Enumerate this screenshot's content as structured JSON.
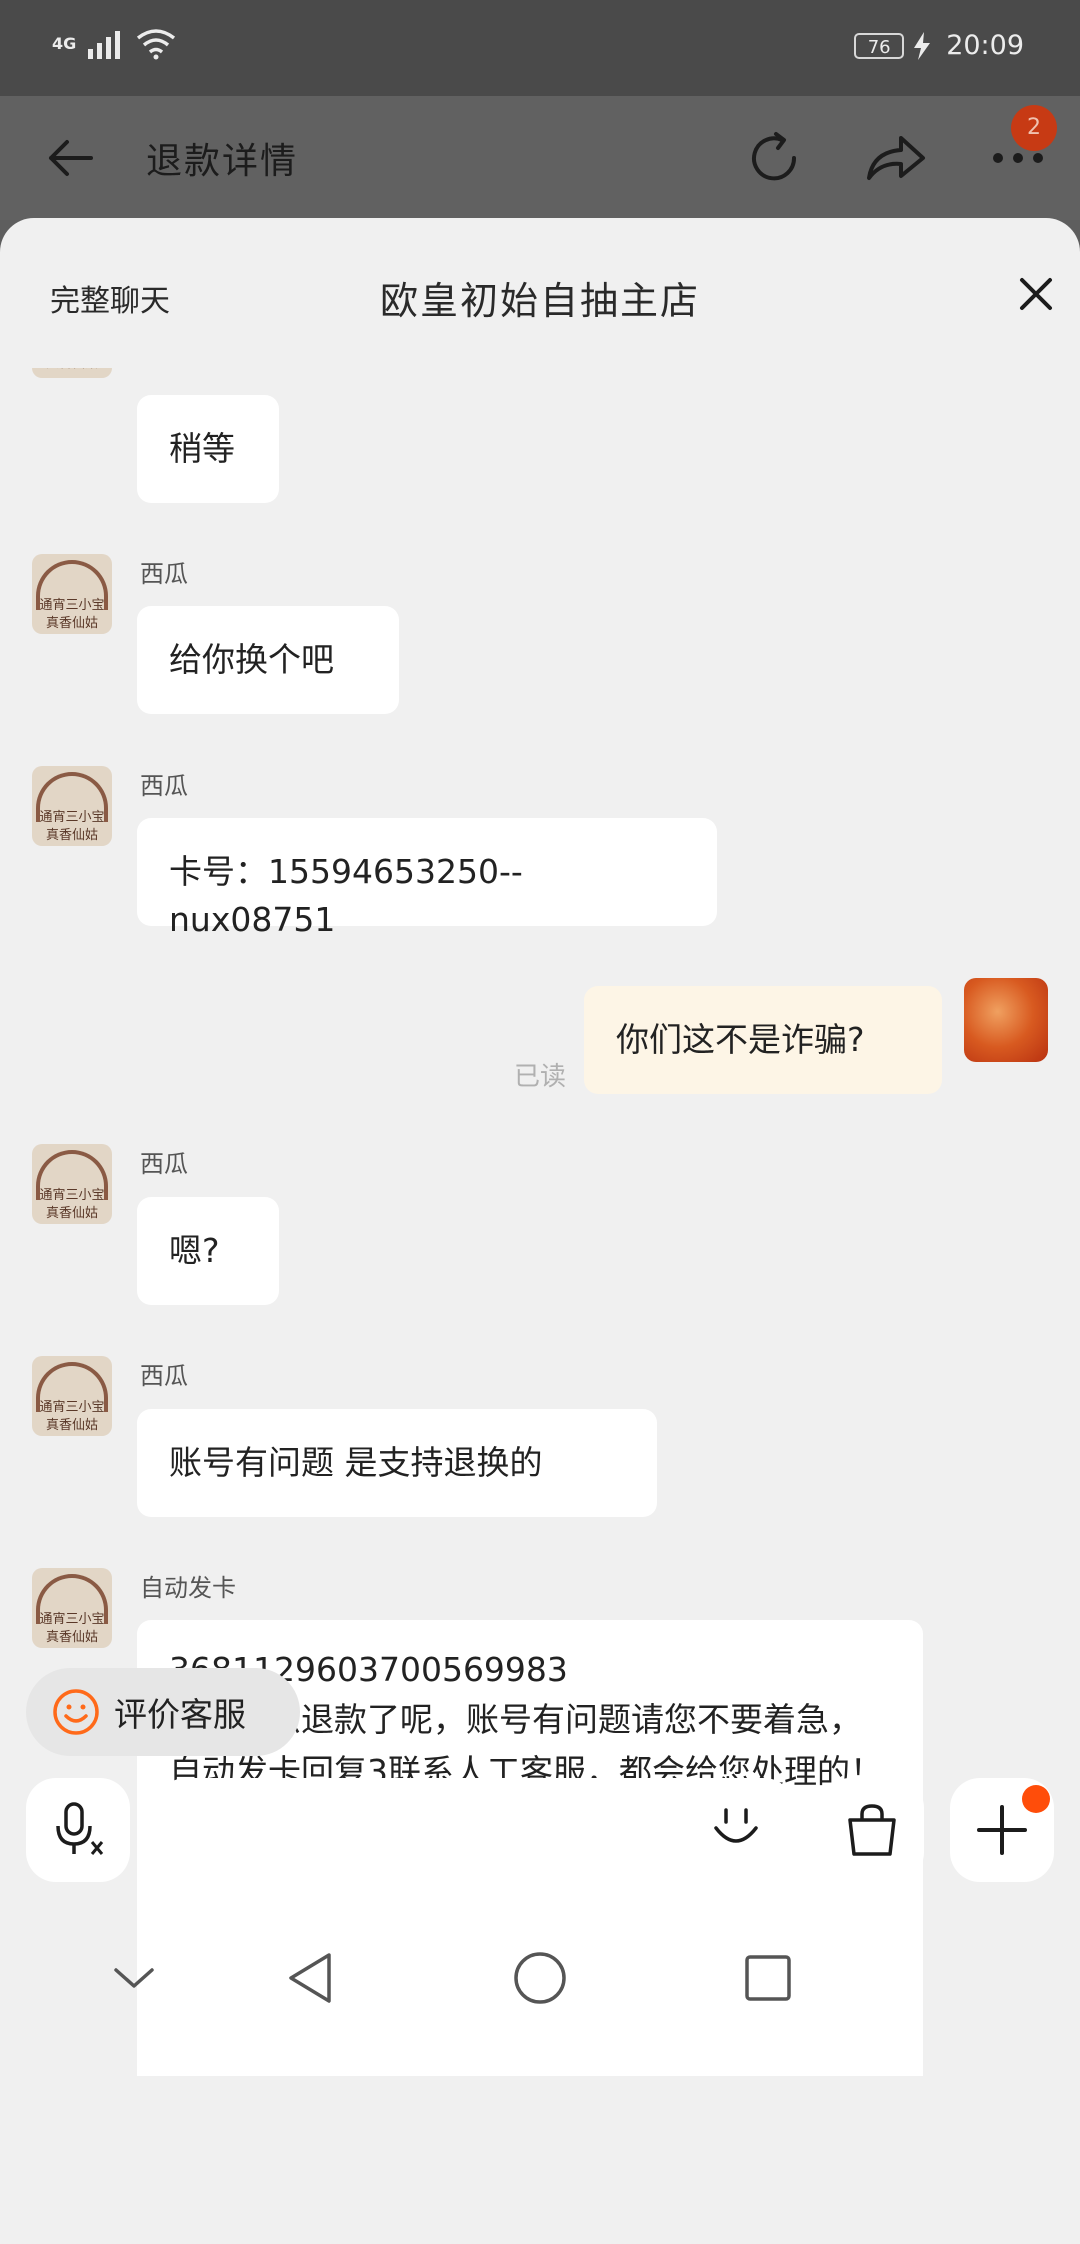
{
  "status_bar": {
    "network": "4G",
    "battery": "76",
    "time": "20:09"
  },
  "header": {
    "title": "退款详情",
    "badge_count": "2"
  },
  "sheet": {
    "full_chat_label": "完整聊天",
    "shop_name": "欧皇初始自抽主店"
  },
  "messages": [
    {
      "sender": "",
      "text": "稍等"
    },
    {
      "sender": "西瓜",
      "text": "给你换个吧"
    },
    {
      "sender": "西瓜",
      "text": "卡号：15594653250--nux08751"
    },
    {
      "sender": "me",
      "text": "你们这不是诈骗?",
      "status": "已读"
    },
    {
      "sender": "西瓜",
      "text": "嗯?"
    },
    {
      "sender": "西瓜",
      "text": "账号有问题 是支持退换的"
    },
    {
      "sender": "自动发卡",
      "text_line1": "3681129603700569983",
      "text_line2": "老板怎么退款了呢，账号有问题请您不要着急，自动发卡回复3联系人工客服，都会给您处理的！不联系客服说明问题退款"
    }
  ],
  "avatar_text": {
    "line1": "通宵三小宝",
    "line2": "真香仙姑"
  },
  "rate_chip": {
    "label": "评价客服"
  },
  "colors": {
    "accent": "#ff4d0a",
    "sheet_bg": "#f0f0f0",
    "my_bubble": "#fdf5e6"
  }
}
